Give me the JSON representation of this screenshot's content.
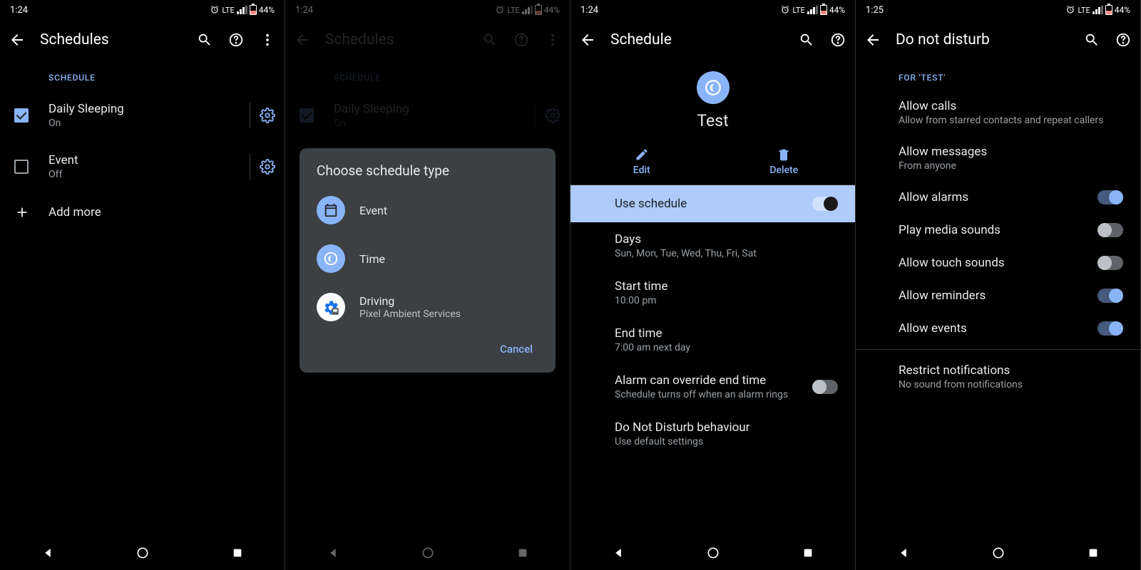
{
  "status": {
    "time1": "1:24",
    "time4": "1:25",
    "lte": "LTE",
    "battery": "44%"
  },
  "s1": {
    "title": "Schedules",
    "section": "SCHEDULE",
    "items": [
      {
        "title": "Daily Sleeping",
        "sub": "On",
        "checked": true
      },
      {
        "title": "Event",
        "sub": "Off",
        "checked": false
      }
    ],
    "add": "Add more"
  },
  "s2": {
    "title": "Schedules",
    "section": "SCHEDULE",
    "item": {
      "title": "Daily Sleeping",
      "sub": "On"
    },
    "dialog": {
      "title": "Choose schedule type",
      "opt1": "Event",
      "opt2": "Time",
      "opt3": {
        "title": "Driving",
        "sub": "Pixel Ambient Services"
      },
      "cancel": "Cancel"
    }
  },
  "s3": {
    "title": "Schedule",
    "hero": "Test",
    "tabs": {
      "edit": "Edit",
      "delete": "Delete"
    },
    "use": "Use schedule",
    "rows": {
      "days": {
        "t": "Days",
        "s": "Sun, Mon, Tue, Wed, Thu, Fri, Sat"
      },
      "start": {
        "t": "Start time",
        "s": "10:00 pm"
      },
      "end": {
        "t": "End time",
        "s": "7:00 am next day"
      },
      "alarm": {
        "t": "Alarm can override end time",
        "s": "Schedule turns off when an alarm rings"
      },
      "dnd": {
        "t": "Do Not Disturb behaviour",
        "s": "Use default settings"
      }
    }
  },
  "s4": {
    "title": "Do not disturb",
    "section": "FOR 'TEST'",
    "rows": {
      "calls": {
        "t": "Allow calls",
        "s": "Allow from starred contacts and repeat callers"
      },
      "msgs": {
        "t": "Allow messages",
        "s": "From anyone"
      },
      "alarms": "Allow alarms",
      "media": "Play media sounds",
      "touch": "Allow touch sounds",
      "reminders": "Allow reminders",
      "events": "Allow events",
      "restrict": {
        "t": "Restrict notifications",
        "s": "No sound from notifications"
      }
    }
  }
}
